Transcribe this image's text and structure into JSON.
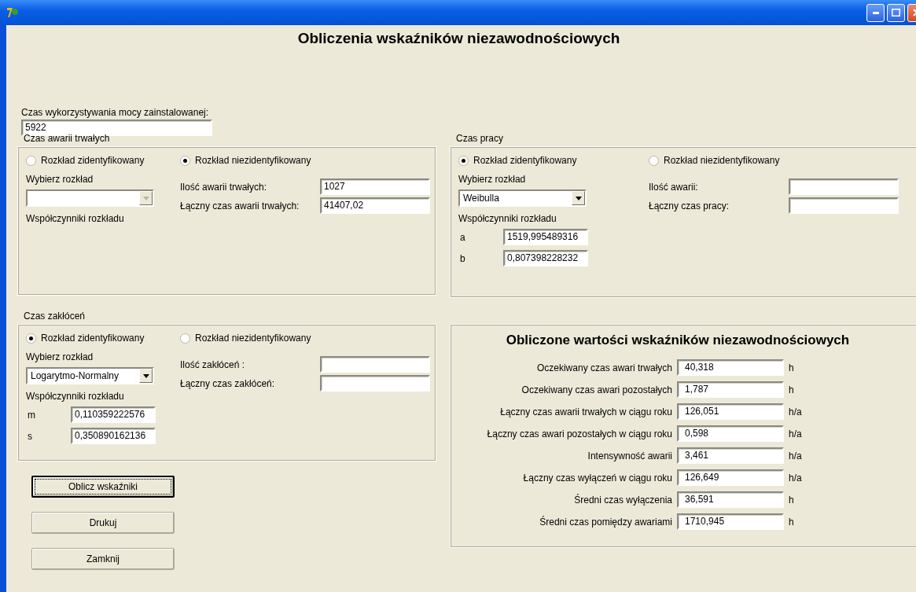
{
  "heading": "Obliczenia wskaźników niezawodnościowych",
  "installed_power_time": {
    "label": "Czas wykorzystywania mocy zainstalowanej:",
    "value": "5922"
  },
  "groups": [
    {
      "title": "Czas awarii trwałych",
      "identified": {
        "label": "Rozkład zidentyfikowany",
        "selected": false,
        "choose_label": "Wybierz rozkład",
        "dropdown": {
          "disabled": true
        },
        "coefficients_label": "Współczynniki rozkładu"
      },
      "unidentified": {
        "label": "Rozkład niezidentyfikowany",
        "selected": true,
        "fields": [
          {
            "label": "Ilość awarii trwałych:",
            "value": "1027"
          },
          {
            "label": "Łączny czas awarii trwałych:",
            "value": "41407,02"
          }
        ]
      }
    },
    {
      "title": "Czas pracy",
      "identified": {
        "label": "Rozkład zidentyfikowany",
        "selected": true,
        "choose_label": "Wybierz rozkład",
        "dropdown": {
          "value": "Weibulla",
          "disabled": false
        },
        "coefficients_label": "Współczynniki rozkładu",
        "coefficients": [
          {
            "name": "a",
            "value": "1519,995489316"
          },
          {
            "name": "b",
            "value": "0,807398228232"
          }
        ]
      },
      "unidentified": {
        "label": "Rozkład niezidentyfikowany",
        "selected": false,
        "fields": [
          {
            "label": "Ilość awarii:"
          },
          {
            "label": "Łączny czas pracy:"
          }
        ]
      }
    },
    {
      "title": "Czas zakłóceń",
      "identified": {
        "label": "Rozkład zidentyfikowany",
        "selected": true,
        "choose_label": "Wybierz rozkład",
        "dropdown": {
          "value": "Logarytmo-Normalny",
          "disabled": false
        },
        "coefficients_label": "Współczynniki rozkładu",
        "coefficients": [
          {
            "name": "m",
            "value": "0,110359222576"
          },
          {
            "name": "s",
            "value": "0,350890162136"
          }
        ]
      },
      "unidentified": {
        "label": "Rozkład niezidentyfikowany",
        "selected": false,
        "fields": [
          {
            "label": "Ilość zakłóceń :"
          },
          {
            "label": "Łączny czas zakłóceń:"
          }
        ]
      }
    }
  ],
  "buttons": [
    {
      "label": "Oblicz wskaźniki",
      "focused": true
    },
    {
      "label": "Drukuj",
      "focused": false
    },
    {
      "label": "Zamknij",
      "focused": false
    }
  ],
  "results": {
    "title": "Obliczone wartości wskaźników niezawodnościowych",
    "rows": [
      {
        "label": "Oczekiwany czas awari trwałych",
        "value": "40,318",
        "unit": "h"
      },
      {
        "label": "Oczekiwany czas awari pozostałych",
        "value": "1,787",
        "unit": "h"
      },
      {
        "label": "Łączny czas awarii trwałych w ciągu roku",
        "value": "126,051",
        "unit": "h/a"
      },
      {
        "label": "Łączny czas awari pozostałych w ciągu roku",
        "value": "0,598",
        "unit": "h/a"
      },
      {
        "label": "Intensywność awarii",
        "value": "3,461",
        "unit": "h/a"
      },
      {
        "label": "Łączny czas wyłączeń w ciągu roku",
        "value": "126,649",
        "unit": "h/a"
      },
      {
        "label": "Średni czas wyłączenia",
        "value": "36,591",
        "unit": "h"
      },
      {
        "label": "Średni czas pomiędzy awariami",
        "value": "1710,945",
        "unit": "h"
      }
    ]
  }
}
